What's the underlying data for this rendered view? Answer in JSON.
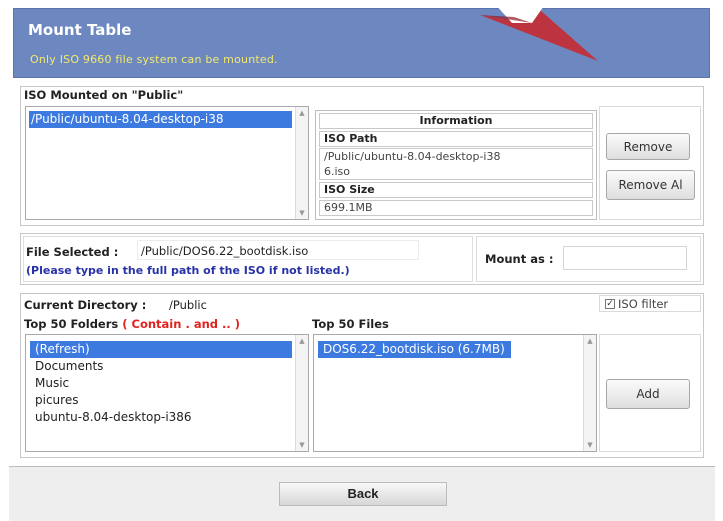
{
  "header": {
    "title": "Mount Table",
    "subtitle": "Only ISO 9660 file system can be mounted."
  },
  "mounted": {
    "heading": "ISO Mounted on \"Public\"",
    "items": [
      "/Public/ubuntu-8.04-desktop-i38"
    ],
    "info": {
      "title": "Information",
      "path_label": "ISO Path",
      "path_line1": "/Public/ubuntu-8.04-desktop-i38",
      "path_line2": "6.iso",
      "size_label": "ISO Size",
      "size_value": "699.1MB"
    },
    "remove_label": "Remove",
    "remove_all_label": "Remove Al"
  },
  "selection": {
    "file_label": "File Selected :",
    "file_value": "/Public/DOS6.22_bootdisk.iso",
    "hint": "(Please type in the full path of the ISO if not listed.)",
    "mount_as_label": "Mount as :",
    "mount_as_value": ""
  },
  "browser": {
    "current_dir_label": "Current Directory :",
    "current_dir_value": "/Public",
    "iso_filter_label": "ISO filter",
    "iso_filter_checked": true,
    "folders_label": "Top 50 Folders",
    "folders_note": "( Contain . and .. )",
    "folders": [
      "(Refresh)",
      "Documents",
      "Music",
      "picures",
      "ubuntu-8.04-desktop-i386"
    ],
    "files_label": "Top 50 Files",
    "files": [
      "DOS6.22_bootdisk.iso (6.7MB)"
    ],
    "add_label": "Add"
  },
  "footer": {
    "back_label": "Back"
  },
  "colors": {
    "header_bg": "#6d88c1",
    "header_sub": "#f2e86b",
    "selection": "#3d7ae0",
    "hint": "#2832a8",
    "note_red": "#e0231e",
    "arrow": "#b3202a"
  }
}
